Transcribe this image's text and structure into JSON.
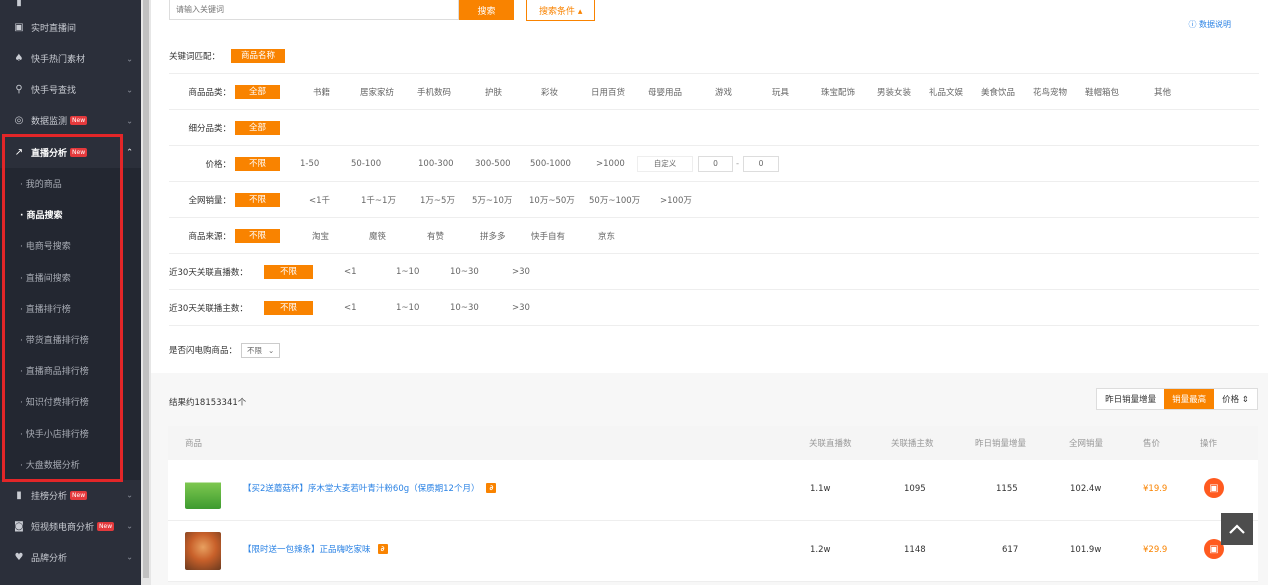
{
  "sidebar": {
    "top_partial_label": "品牌分析",
    "items_top": [
      {
        "label": "实时直播间",
        "icon": "tv-icon"
      },
      {
        "label": "快手热门素材",
        "icon": "fire-icon",
        "chevron": "⌄"
      },
      {
        "label": "快手号查找",
        "icon": "search-icon",
        "chevron": "⌄"
      },
      {
        "label": "数据监测",
        "icon": "monitor-icon",
        "badge": "New",
        "chevron": "⌄"
      }
    ],
    "active_parent": {
      "label": "直播分析",
      "icon": "trend-icon",
      "badge": "New",
      "chevron": "⌃"
    },
    "submenu": [
      "· 我的商品",
      "· 商品搜索",
      "· 电商号搜索",
      "· 直播间搜索",
      "· 直播排行榜",
      "· 带货直播排行榜",
      "· 直播商品排行榜",
      "· 知识付费排行榜",
      "· 快手小店排行榜",
      "· 大盘数据分析"
    ],
    "items_bottom": [
      {
        "label": "挂榜分析",
        "icon": "bar-chart-icon",
        "badge": "New",
        "chevron": "⌄"
      },
      {
        "label": "短视频电商分析",
        "icon": "bag-icon",
        "badge": "New",
        "chevron": "⌄"
      },
      {
        "label": "品牌分析",
        "icon": "diamond-icon",
        "chevron": "⌄"
      }
    ]
  },
  "search": {
    "placeholder": "请输入关键词",
    "search_button": "搜索",
    "conditions_button": "搜索条件 ▴",
    "help_link": "ⓘ 数据说明"
  },
  "filters": {
    "keyword_match": {
      "label": "关键词匹配：",
      "active": "商品名称"
    },
    "category": {
      "label": "商品品类：",
      "active": "全部",
      "options": [
        "书籍",
        "居家家纺",
        "手机数码",
        "护肤",
        "彩妆",
        "日用百货",
        "母婴用品",
        "游戏",
        "玩具",
        "珠宝配饰",
        "男装女装",
        "礼品文娱",
        "美食饮品",
        "花鸟宠物",
        "鞋帽箱包",
        "其他"
      ]
    },
    "subcategory": {
      "label": "细分品类：",
      "active": "全部"
    },
    "price": {
      "label": "价格：",
      "active": "不限",
      "options": [
        "1-50",
        "50-100",
        "100-300",
        "300-500",
        "500-1000",
        ">1000"
      ],
      "custom": "自定义",
      "min": "0",
      "max": "0",
      "sep": "-"
    },
    "sales": {
      "label": "全网销量：",
      "active": "不限",
      "options": [
        "<1千",
        "1千~1万",
        "1万~5万",
        "5万~10万",
        "10万~50万",
        "50万~100万",
        ">100万"
      ]
    },
    "source": {
      "label": "商品来源：",
      "active": "不限",
      "options": [
        "淘宝",
        "魔筷",
        "有赞",
        "拼多多",
        "快手自有",
        "京东"
      ]
    },
    "live_count": {
      "label": "近30天关联直播数：",
      "active": "不限",
      "options": [
        "<1",
        "1~10",
        "10~30",
        ">30"
      ]
    },
    "anchor_count": {
      "label": "近30天关联播主数：",
      "active": "不限",
      "options": [
        "<1",
        "1~10",
        "10~30",
        ">30"
      ]
    },
    "flash": {
      "label": "是否闪电购商品：",
      "value": "不限",
      "arrow": "⌄"
    }
  },
  "results": {
    "count_text": "结果约18153341个",
    "sort": [
      "昨日销量增量",
      "销量最高",
      "价格 ⇕"
    ],
    "columns": [
      "商品",
      "关联直播数",
      "关联播主数",
      "昨日销量增量",
      "全网销量",
      "售价",
      "操作"
    ],
    "rows": [
      {
        "title": "【买2送蘑菇杯】序木堂大麦若叶青汁粉60g（保质期12个月）",
        "live": "1.1w",
        "anchors": "1095",
        "yesterday": "1155",
        "total": "102.4w",
        "price": "¥19.9"
      },
      {
        "title": "【限时送一包辣条】正品嗨吃家味",
        "live": "1.2w",
        "anchors": "1148",
        "yesterday": "617",
        "total": "101.9w",
        "price": "¥29.9"
      }
    ]
  },
  "colors": {
    "accent": "#f98300",
    "sidebar_bg": "#2b2f3a",
    "highlight": "#e32628",
    "link": "#2a82e4"
  }
}
